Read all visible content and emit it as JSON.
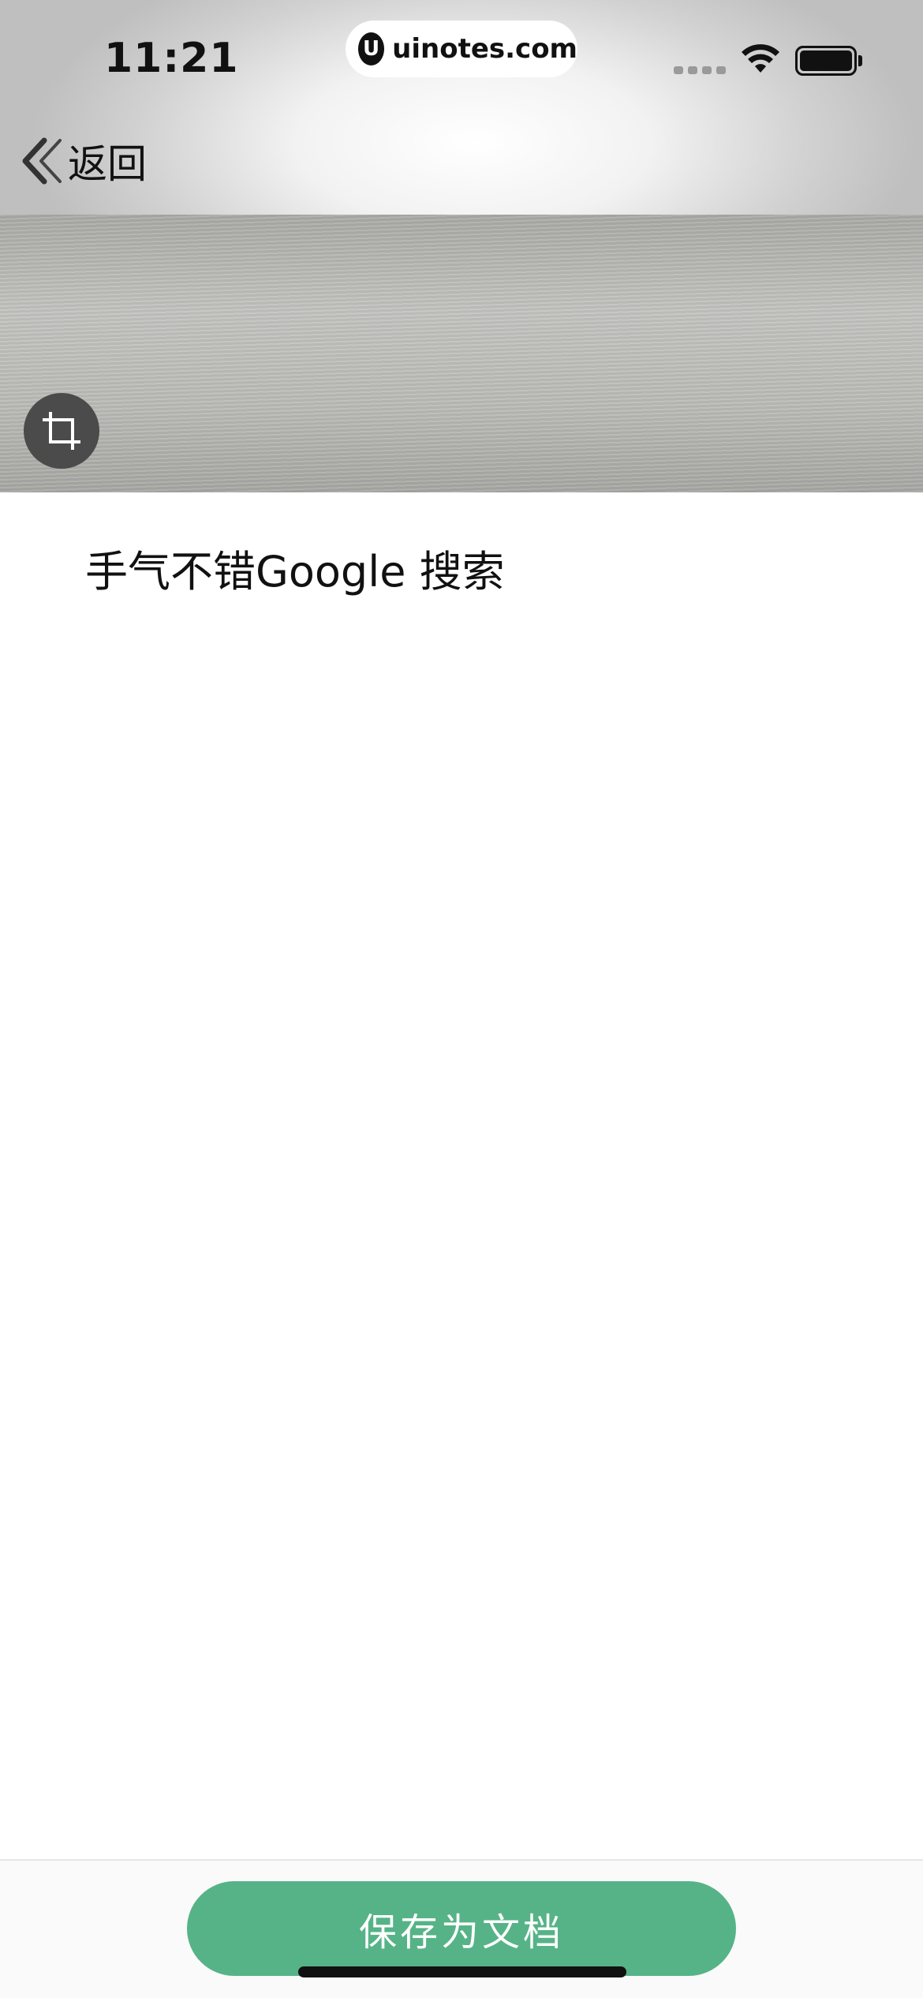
{
  "status_bar": {
    "time": "11:21",
    "url": "uinotes.com",
    "url_logo_letter": "U"
  },
  "nav": {
    "back_label": "返回"
  },
  "content": {
    "recognized_text": "手气不错Google 搜索"
  },
  "footer": {
    "save_button_label": "保存为文档"
  },
  "colors": {
    "accent": "#56b387",
    "text": "#111111",
    "crop_button_bg": "#4b4b4b"
  }
}
